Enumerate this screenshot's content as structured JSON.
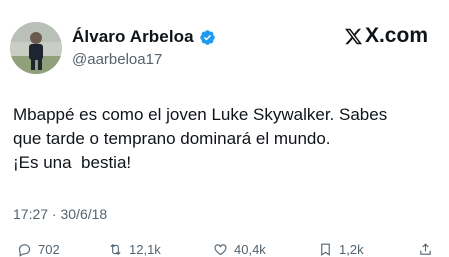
{
  "author": {
    "name": "Álvaro Arbeloa",
    "handle": "@aarbeloa17",
    "verified": true,
    "verified_color": "#1d9bf0"
  },
  "brand": {
    "label": "X.com"
  },
  "tweet": {
    "text": "Mbappé es como el joven Luke Skywalker. Sabes\nque tarde o temprano dominará el mundo.\n¡Es una  bestia!",
    "timestamp": "17:27 · 30/6/18"
  },
  "actions": [
    {
      "icon": "reply-icon",
      "count": "702"
    },
    {
      "icon": "retweet-icon",
      "count": "12,1k"
    },
    {
      "icon": "like-icon",
      "count": "40,4k"
    },
    {
      "icon": "bookmark-icon",
      "count": "1,2k"
    },
    {
      "icon": "share-icon",
      "count": ""
    }
  ]
}
